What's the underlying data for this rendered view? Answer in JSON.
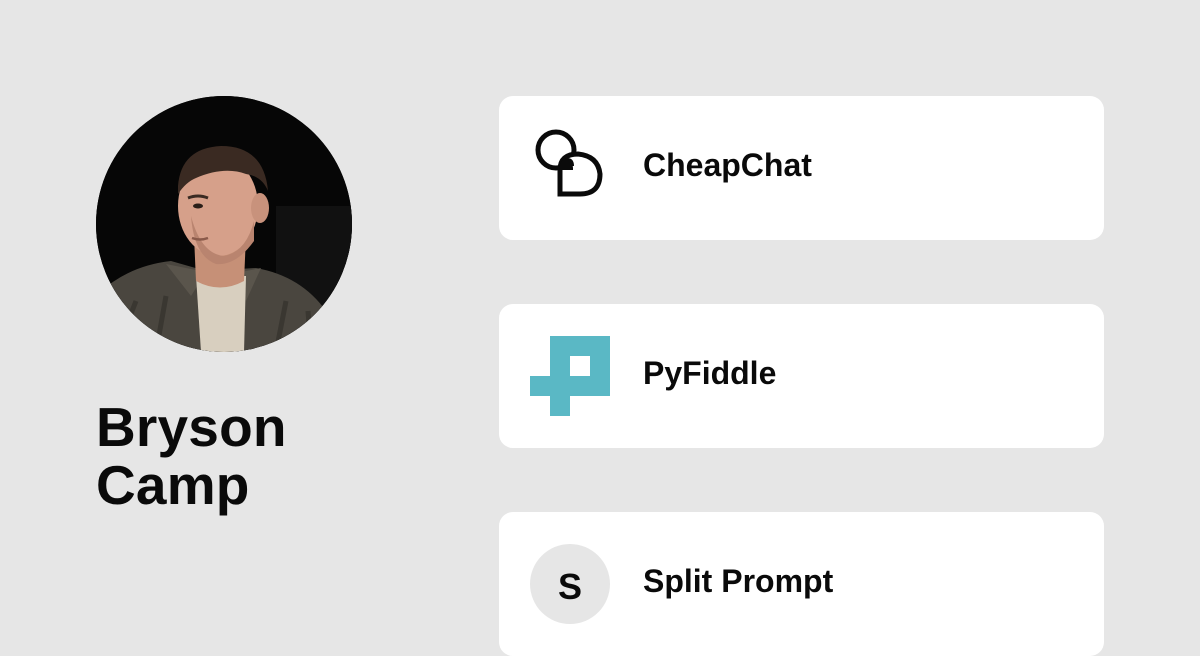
{
  "profile": {
    "first_name": "Bryson",
    "last_name": "Camp",
    "avatar_icon": "profile-photo"
  },
  "links": [
    {
      "label": "CheapChat",
      "icon": "overlapping-chat-bubbles-icon"
    },
    {
      "label": "PyFiddle",
      "icon": "teal-pixel-p-logo",
      "color": "#5ab8c5"
    },
    {
      "label": "Split Prompt",
      "icon_letter": "S",
      "icon": "letter-s-badge"
    }
  ],
  "colors": {
    "background": "#e6e6e6",
    "card": "#ffffff",
    "text": "#0a0a0a",
    "pyfiddle_accent": "#5ab8c5"
  }
}
